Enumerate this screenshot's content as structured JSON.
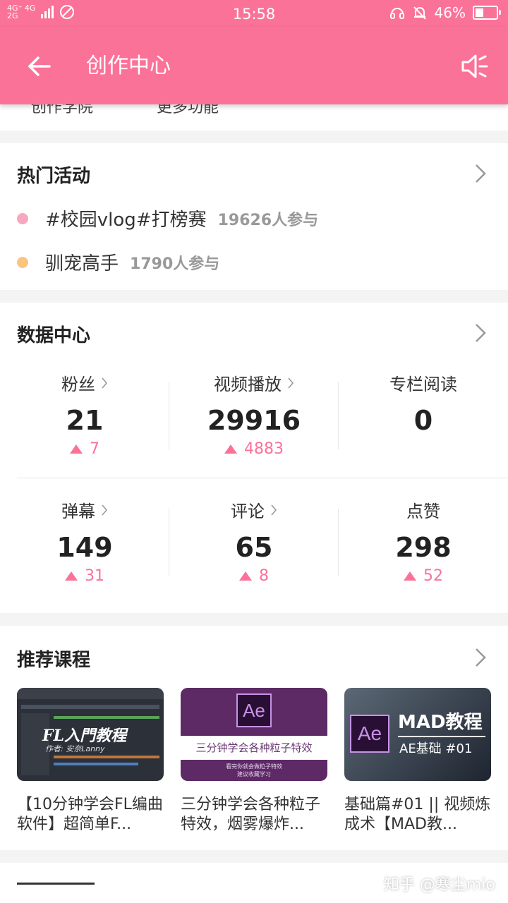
{
  "status_bar": {
    "network_top": "4G⁺ 4G",
    "network_bottom": "2G",
    "time": "15:58",
    "battery": "46%",
    "battery_level": 0.46,
    "icons": [
      "headphones-icon",
      "bell-muted-icon",
      "battery-icon",
      "no-sim-icon"
    ]
  },
  "header": {
    "title": "创作中心",
    "back_icon": "arrow-left-icon",
    "sound_icon": "speaker-muted-icon"
  },
  "peek": {
    "left": "创作学院",
    "right": "更多功能"
  },
  "hot_activities": {
    "title": "热门活动",
    "items": [
      {
        "name": "#校园vlog#打榜赛",
        "count": "19626人参与",
        "dot_color": "#f7a8c0"
      },
      {
        "name": "驯宠高手",
        "count": "1790人参与",
        "dot_color": "#fcc57f"
      }
    ]
  },
  "data_center": {
    "title": "数据中心",
    "stats": [
      {
        "label": "粉丝",
        "value": "21",
        "delta": "7"
      },
      {
        "label": "视频播放",
        "value": "29916",
        "delta": "4883"
      },
      {
        "label": "专栏阅读",
        "value": "0",
        "delta": ""
      },
      {
        "label": "弹幕",
        "value": "149",
        "delta": "31"
      },
      {
        "label": "评论",
        "value": "65",
        "delta": "8"
      },
      {
        "label": "点赞",
        "value": "298",
        "delta": "52"
      }
    ]
  },
  "courses": {
    "title": "推荐课程",
    "items": [
      {
        "thumb_title": "FL入門教程",
        "thumb_sub": "作者: 安奈Lanny",
        "title": "【10分钟学会FL编曲软件】超简单F..."
      },
      {
        "thumb_title": "三分钟学会各种粒子特效",
        "thumb_badge": "Ae",
        "thumb_sub1": "看完你就会做粒子特效",
        "thumb_sub2": "建议收藏学习",
        "title": "三分钟学会各种粒子特效，烟雾爆炸..."
      },
      {
        "thumb_title": "MAD教程",
        "thumb_badge": "Ae",
        "thumb_sub": "AE基础 #01",
        "title": "基础篇#01 || 视频炼成术【MAD教..."
      }
    ]
  },
  "watermark": "知乎 @寒尘mio",
  "colors": {
    "accent": "#fb7299",
    "background": "#f4f4f4"
  }
}
